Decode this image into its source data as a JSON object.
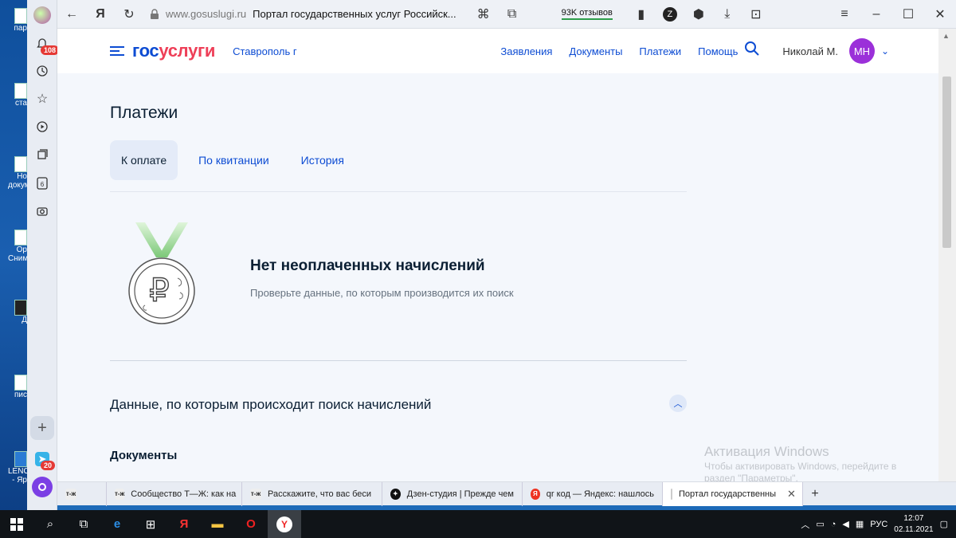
{
  "desktop": {
    "icons": [
      {
        "label": "пар"
      },
      {
        "label": "ста"
      },
      {
        "label": "Но докум"
      },
      {
        "label": "Ор Сним"
      },
      {
        "label": "Д"
      },
      {
        "label": "пис"
      },
      {
        "label": "LENO - Яр"
      }
    ]
  },
  "browser_sidebar": {
    "notifications_badge": "108",
    "messenger_badge": "20"
  },
  "browser": {
    "address_domain": "www.gosuslugi.ru",
    "page_title": "Портал государственных услуг Российск...",
    "reviews": "93K отзывов"
  },
  "site": {
    "logo_part1": "гос",
    "logo_part2": "услуги",
    "region": "Ставрополь г",
    "nav": [
      "Заявления",
      "Документы",
      "Платежи",
      "Помощь"
    ],
    "user_name": "Николай М.",
    "user_initials": "МН"
  },
  "main": {
    "title": "Платежи",
    "tabs": [
      {
        "label": "К оплате",
        "active": true
      },
      {
        "label": "По квитанции"
      },
      {
        "label": "История"
      }
    ],
    "empty_title": "Нет неоплаченных начислений",
    "empty_text": "Проверьте данные, по которым производится их поиск",
    "section_title": "Данные, по которым происходит поиск начислений",
    "docs_title": "Документы"
  },
  "activation": {
    "title": "Активация Windows",
    "text1": "Чтобы активировать Windows, перейдите в",
    "text2": "раздел \"Параметры\"."
  },
  "tabs": [
    {
      "label": "Сообщество Т—Ж: как на",
      "fav": "т-ж"
    },
    {
      "label": "Расскажите, что вас беси",
      "fav": "т-ж"
    },
    {
      "label": "Дзен-студия | Прежде чем",
      "fav": "✦"
    },
    {
      "label": "qr код — Яндекс: нашлось",
      "fav": "Я"
    },
    {
      "label": "Портал государственны",
      "fav": "flag",
      "active": true
    }
  ],
  "taskbar": {
    "lang": "РУС",
    "time": "12:07",
    "date": "02.11.2021"
  }
}
